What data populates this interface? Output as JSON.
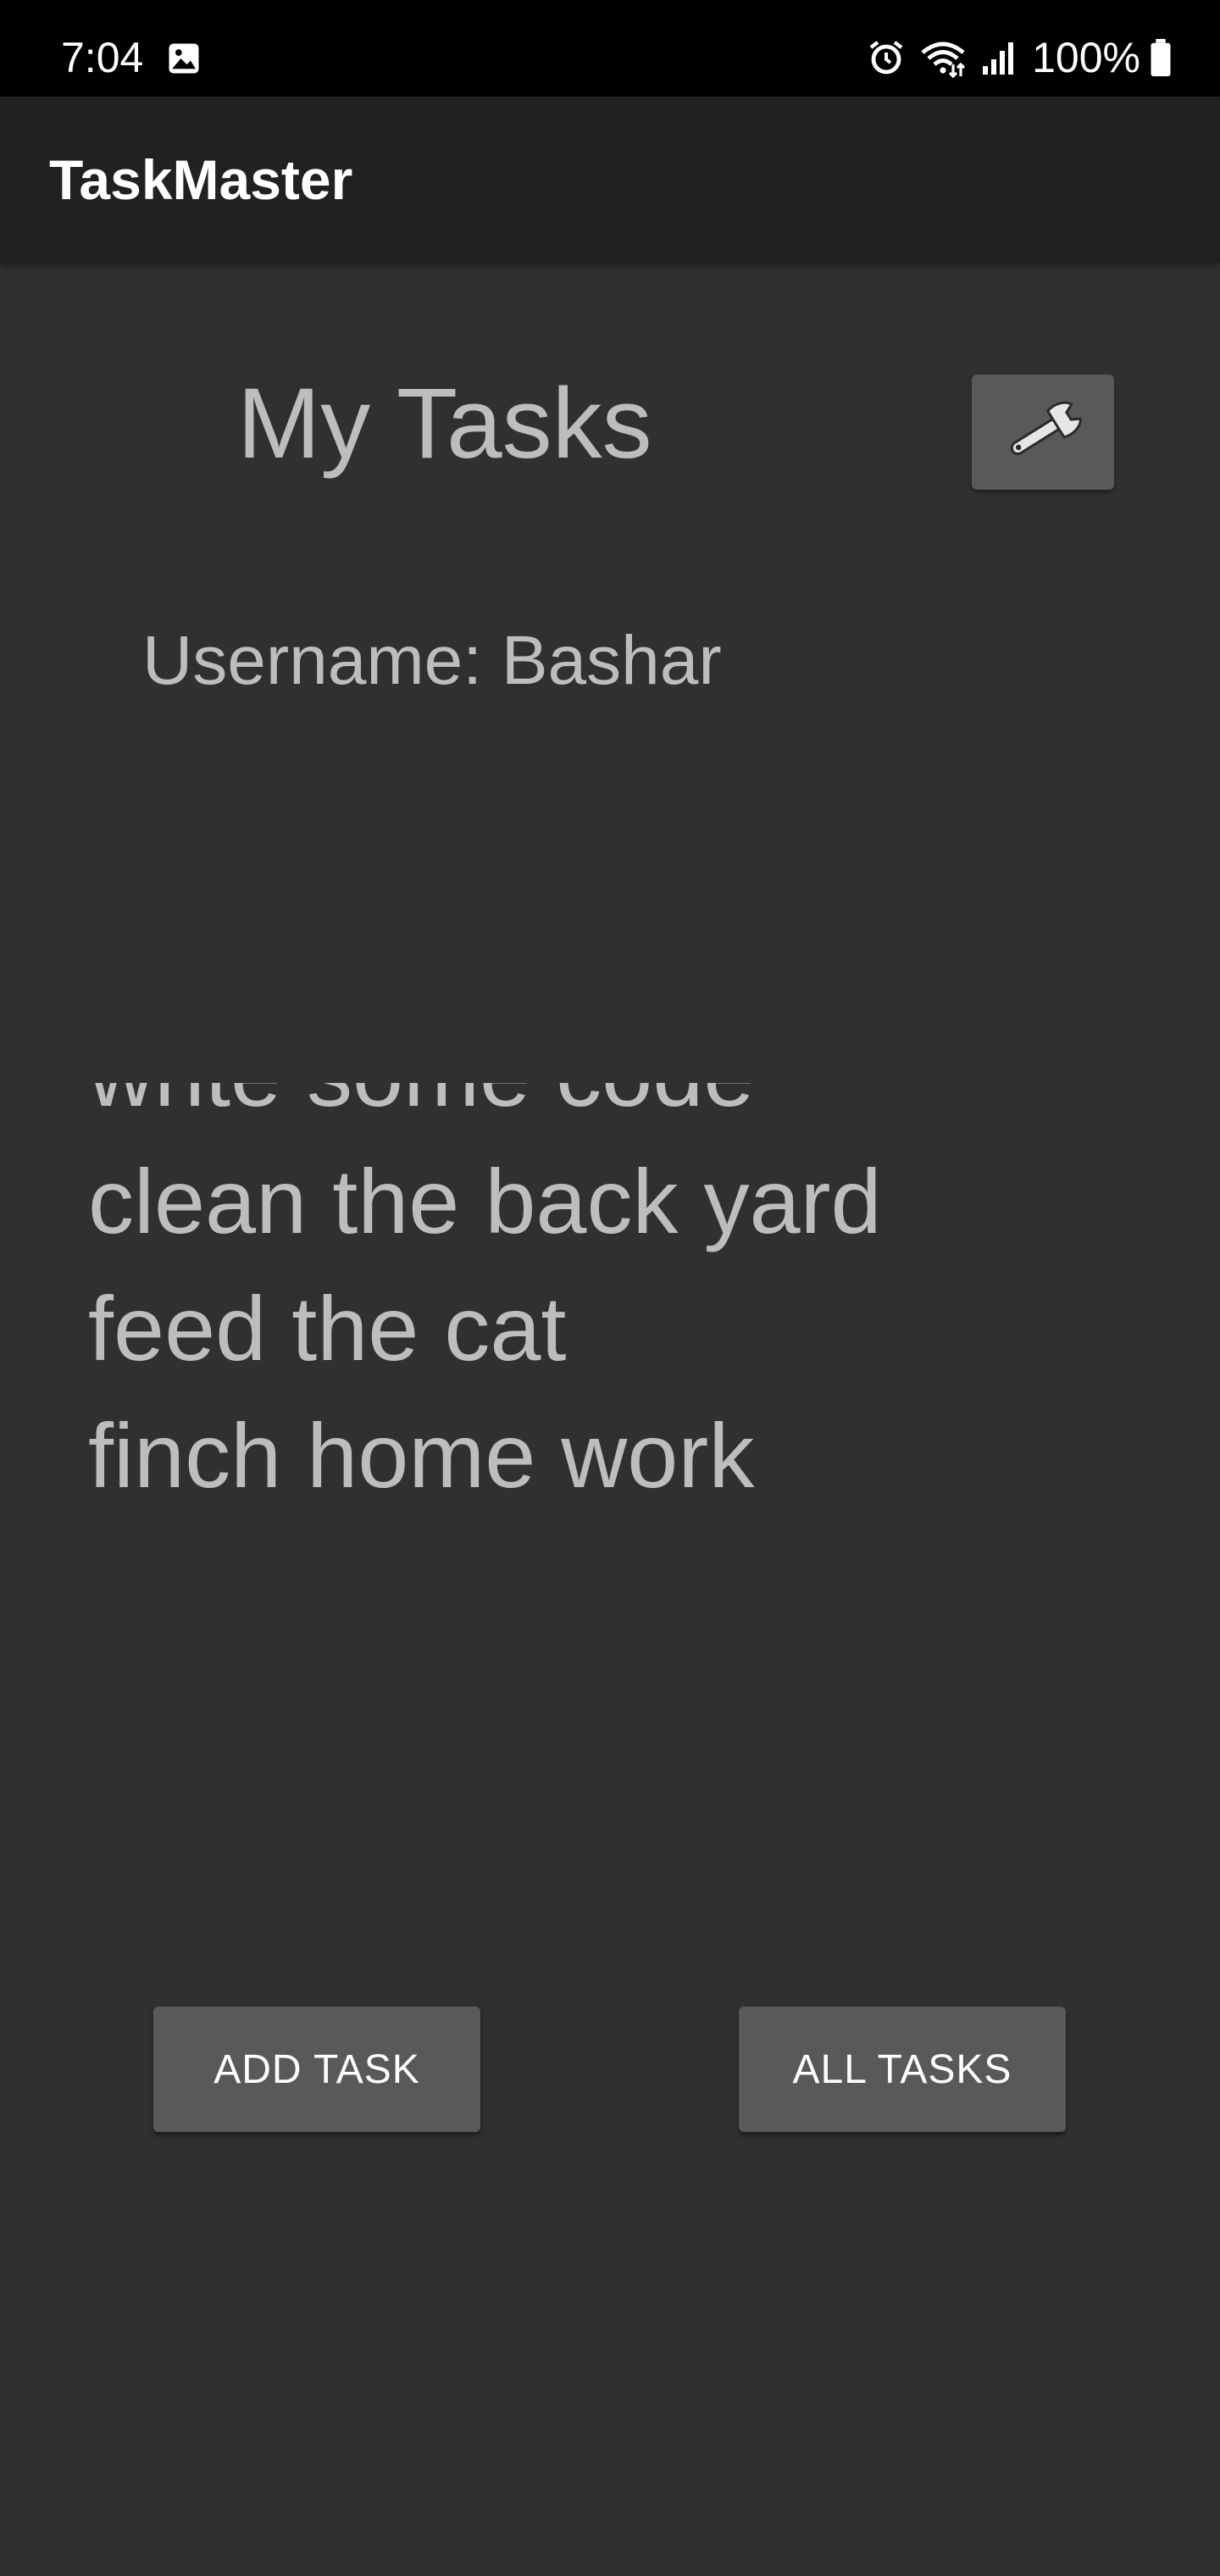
{
  "status_bar": {
    "time": "7:04",
    "battery_text": "100%",
    "icons": [
      "gallery-icon",
      "alarm-icon",
      "wifi-icon",
      "signal-icon",
      "battery-icon"
    ]
  },
  "app_bar": {
    "title": "TaskMaster"
  },
  "header": {
    "title": "My Tasks",
    "settings_icon": "wrench-icon"
  },
  "user": {
    "label": "Username: Bashar"
  },
  "tasks": [
    "write some code",
    "clean the back yard",
    "feed the cat",
    "finch home work"
  ],
  "actions": {
    "add_task_label": "ADD TASK",
    "all_tasks_label": "ALL TASKS"
  },
  "colors": {
    "background": "#303030",
    "app_bar": "#212121",
    "status_bar": "#000000",
    "button": "#595959",
    "text_muted": "#bdbdbd",
    "text_primary": "#ffffff"
  }
}
